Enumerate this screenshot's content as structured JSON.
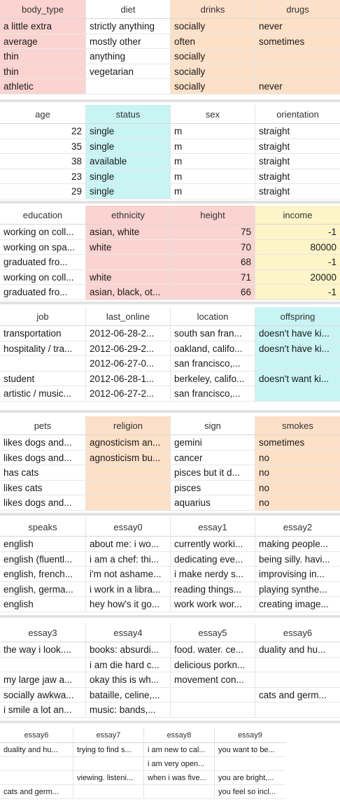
{
  "tables": [
    {
      "headers": [
        "body_type",
        "diet",
        "drinks",
        "drugs"
      ],
      "rows": [
        [
          "a little extra",
          "strictly anything",
          "socially",
          "never"
        ],
        [
          "average",
          "mostly other",
          "often",
          "sometimes"
        ],
        [
          "thin",
          "anything",
          "socially",
          ""
        ],
        [
          "thin",
          "vegetarian",
          "socially",
          ""
        ],
        [
          "athletic",
          "",
          "socially",
          "never"
        ]
      ]
    },
    {
      "headers": [
        "age",
        "status",
        "sex",
        "orientation"
      ],
      "rows": [
        [
          "22",
          "single",
          "m",
          "straight"
        ],
        [
          "35",
          "single",
          "m",
          "straight"
        ],
        [
          "38",
          "available",
          "m",
          "straight"
        ],
        [
          "23",
          "single",
          "m",
          "straight"
        ],
        [
          "29",
          "single",
          "m",
          "straight"
        ]
      ]
    },
    {
      "headers": [
        "education",
        "ethnicity",
        "height",
        "income"
      ],
      "rows": [
        [
          "working on coll...",
          "asian, white",
          "75",
          "-1"
        ],
        [
          "working on spa...",
          "white",
          "70",
          "80000"
        ],
        [
          "graduated fro...",
          "",
          "68",
          "-1"
        ],
        [
          "working on coll...",
          "white",
          "71",
          "20000"
        ],
        [
          "graduated fro...",
          "asian, black, ot...",
          "66",
          "-1"
        ]
      ]
    },
    {
      "headers": [
        "job",
        "last_online",
        "location",
        "offspring"
      ],
      "rows": [
        [
          "transportation",
          "2012-06-28-2...",
          "south san fran...",
          "doesn't have ki..."
        ],
        [
          "hospitality / tra...",
          "2012-06-29-2...",
          "oakland, califo...",
          "doesn't have ki..."
        ],
        [
          "",
          "2012-06-27-0...",
          "san francisco,...",
          ""
        ],
        [
          "student",
          "2012-06-28-1...",
          "berkeley, califo...",
          "doesn't want ki..."
        ],
        [
          "artistic / music...",
          "2012-06-27-2...",
          "san francisco,...",
          ""
        ]
      ]
    },
    {
      "headers": [
        "pets",
        "religion",
        "sign",
        "smokes"
      ],
      "rows": [
        [
          "likes dogs and...",
          "agnosticism an...",
          "gemini",
          "sometimes"
        ],
        [
          "likes dogs and...",
          "agnosticism bu...",
          "cancer",
          "no"
        ],
        [
          "has cats",
          "",
          "pisces but it d...",
          "no"
        ],
        [
          "likes cats",
          "",
          "pisces",
          "no"
        ],
        [
          "likes dogs and...",
          "",
          "aquarius",
          "no"
        ]
      ]
    },
    {
      "headers": [
        "speaks",
        "essay0",
        "essay1",
        "essay2"
      ],
      "rows": [
        [
          "english",
          "about me:  i wo...",
          "currently worki...",
          "making people..."
        ],
        [
          "english (fluentl...",
          "i am a chef: thi...",
          "dedicating eve...",
          "being silly. havi..."
        ],
        [
          "english, french...",
          "i'm not ashame...",
          "i make nerdy s...",
          "improvising in..."
        ],
        [
          "english, germa...",
          "i work in a libra...",
          "reading things...",
          "playing synthe..."
        ],
        [
          "english",
          "hey how's it go...",
          "work work wor...",
          "creating image..."
        ]
      ]
    },
    {
      "headers": [
        "essay3",
        "essay4",
        "essay5",
        "essay6"
      ],
      "rows": [
        [
          "the way i look....",
          "books: absurdi...",
          "food. water. ce...",
          "duality and hu..."
        ],
        [
          "",
          "i am die hard c...",
          "delicious porkn...",
          ""
        ],
        [
          "my large jaw a...",
          "okay this is wh...",
          "movement con...",
          ""
        ],
        [
          "socially awkwa...",
          "bataille, celine,...",
          "",
          "cats and germ..."
        ],
        [
          "i smile a lot an...",
          "music: bands,...",
          "",
          ""
        ]
      ]
    },
    {
      "headers": [
        "essay6",
        "essay7",
        "essay8",
        "essay9"
      ],
      "rows": [
        [
          "duality and hu...",
          "trying to find s...",
          "i am new to cal...",
          "you want to be..."
        ],
        [
          "",
          "",
          "i am very open...",
          ""
        ],
        [
          "",
          "viewing. listeni...",
          "when i was five...",
          "you are bright,..."
        ],
        [
          "cats and germ...",
          "",
          "",
          "you feel so incl..."
        ]
      ]
    }
  ]
}
